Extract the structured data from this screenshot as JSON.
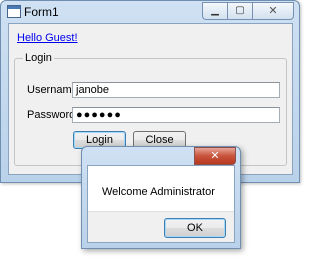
{
  "form": {
    "title": "Form1",
    "icons": {
      "app": "form-window-icon",
      "minimize": "minimize-icon",
      "maximize": "maximize-icon",
      "close": "close-icon"
    },
    "greeting_link": "Hello Guest!",
    "group_title": "Login",
    "username_label": "Username :",
    "username_value": "janobe",
    "password_label": "Password :",
    "password_mask": "●●●●●●",
    "login_button": "Login",
    "close_button": "Close"
  },
  "message_box": {
    "message": "Welcome Administrator",
    "ok_button": "OK",
    "close_icon": "close-icon"
  },
  "colors": {
    "titlebar": "#cfe1f3",
    "link": "#0000ee",
    "client_bg": "#f0f0f0",
    "close_button": "#c8533c"
  }
}
